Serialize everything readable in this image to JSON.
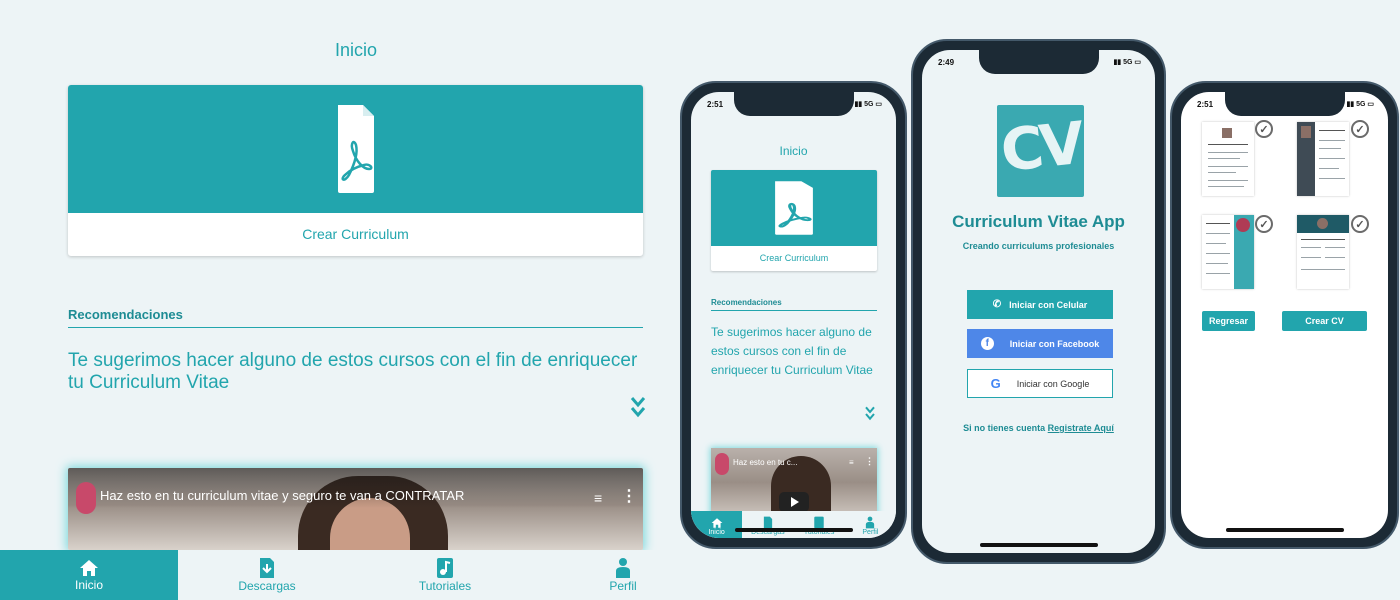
{
  "home": {
    "title": "Inicio",
    "card_label": "Crear Curriculum",
    "reco_title": "Recomendaciones",
    "reco_text": "Te sugerimos hacer alguno de estos cursos con el fin de enriquecer tu Curriculum Vitae",
    "video_title": "Haz esto en tu curriculum vitae y seguro te van a CONTRATAR",
    "video_title_short": "Haz esto en tu c...",
    "nav": [
      {
        "label": "Inicio",
        "icon": "home-icon"
      },
      {
        "label": "Descargas",
        "icon": "download-icon"
      },
      {
        "label": "Tutoriales",
        "icon": "music-note-icon"
      },
      {
        "label": "Perfil",
        "icon": "user-icon"
      }
    ]
  },
  "phone_status": {
    "time_1": "2:51",
    "time_2": "2:49",
    "time_3": "2:51",
    "signal": "5G"
  },
  "login": {
    "logo_text": "CV",
    "app_name": "Curriculum Vitae App",
    "subtitle": "Creando curriculums profesionales",
    "btn_phone": "Iniciar con Celular",
    "btn_facebook": "Iniciar con Facebook",
    "btn_google": "Iniciar con Google",
    "signup_prefix": "Si no tienes cuenta",
    "signup_link": "Registrate Aquí"
  },
  "templates": {
    "btn_back": "Regresar",
    "btn_create": "Crear CV"
  },
  "colors": {
    "primary": "#22a5ad",
    "facebook": "#4e87e8",
    "background": "#edf4f6"
  }
}
